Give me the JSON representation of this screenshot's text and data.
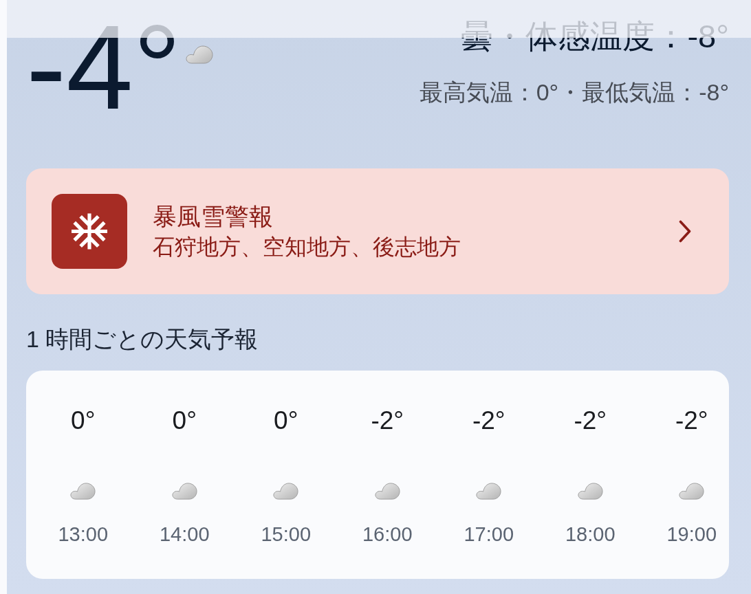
{
  "current": {
    "temperature": "-4°",
    "summary": "曇・体感温度：-8°",
    "high_low": "最高気温：0°・最低気温：-8°"
  },
  "alert": {
    "title": "暴風雪警報",
    "areas": "石狩地方、空知地方、後志地方"
  },
  "hourly": {
    "title": "1 時間ごとの天気予報",
    "items": [
      {
        "temperature": "0°",
        "time": "13:00"
      },
      {
        "temperature": "0°",
        "time": "14:00"
      },
      {
        "temperature": "0°",
        "time": "15:00"
      },
      {
        "temperature": "-2°",
        "time": "16:00"
      },
      {
        "temperature": "-2°",
        "time": "17:00"
      },
      {
        "temperature": "-2°",
        "time": "18:00"
      },
      {
        "temperature": "-2°",
        "time": "19:00"
      }
    ]
  }
}
